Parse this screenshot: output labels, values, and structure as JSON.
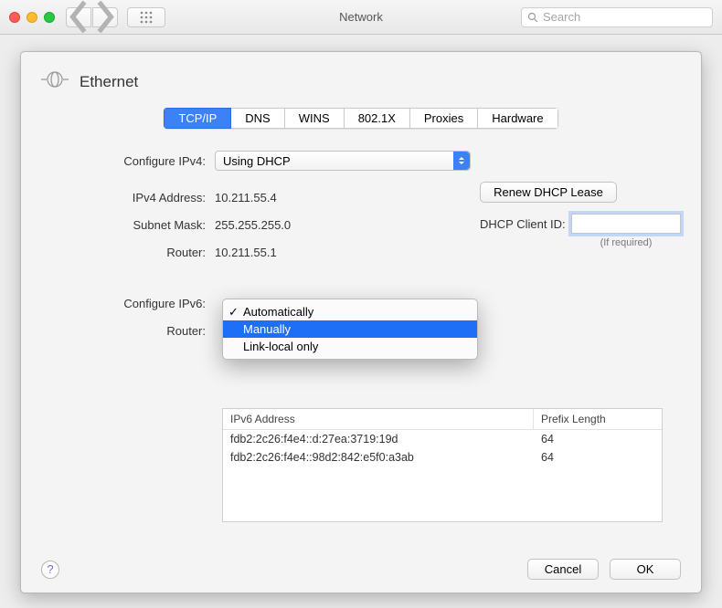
{
  "titlebar": {
    "window_title": "Network",
    "search_placeholder": "Search"
  },
  "header": {
    "interface_name": "Ethernet"
  },
  "tabs": [
    "TCP/IP",
    "DNS",
    "WINS",
    "802.1X",
    "Proxies",
    "Hardware"
  ],
  "active_tab_index": 0,
  "ipv4": {
    "configure_label": "Configure IPv4:",
    "configure_value": "Using DHCP",
    "address_label": "IPv4 Address:",
    "address_value": "10.211.55.4",
    "subnet_label": "Subnet Mask:",
    "subnet_value": "255.255.255.0",
    "router_label": "Router:",
    "router_value": "10.211.55.1",
    "renew_button": "Renew DHCP Lease",
    "dhcp_client_label": "DHCP Client ID:",
    "dhcp_client_value": "",
    "dhcp_client_hint": "(If required)"
  },
  "ipv6": {
    "configure_label": "Configure IPv6:",
    "router_label": "Router:",
    "dropdown_options": [
      "Automatically",
      "Manually",
      "Link-local only"
    ],
    "dropdown_selected_index": 0,
    "dropdown_highlight_index": 1,
    "table": {
      "col1": "IPv6 Address",
      "col2": "Prefix Length",
      "rows": [
        {
          "addr": "fdb2:2c26:f4e4::d:27ea:3719:19d",
          "prefix": "64"
        },
        {
          "addr": "fdb2:2c26:f4e4::98d2:842:e5f0:a3ab",
          "prefix": "64"
        }
      ]
    }
  },
  "footer": {
    "help": "?",
    "cancel": "Cancel",
    "ok": "OK"
  }
}
